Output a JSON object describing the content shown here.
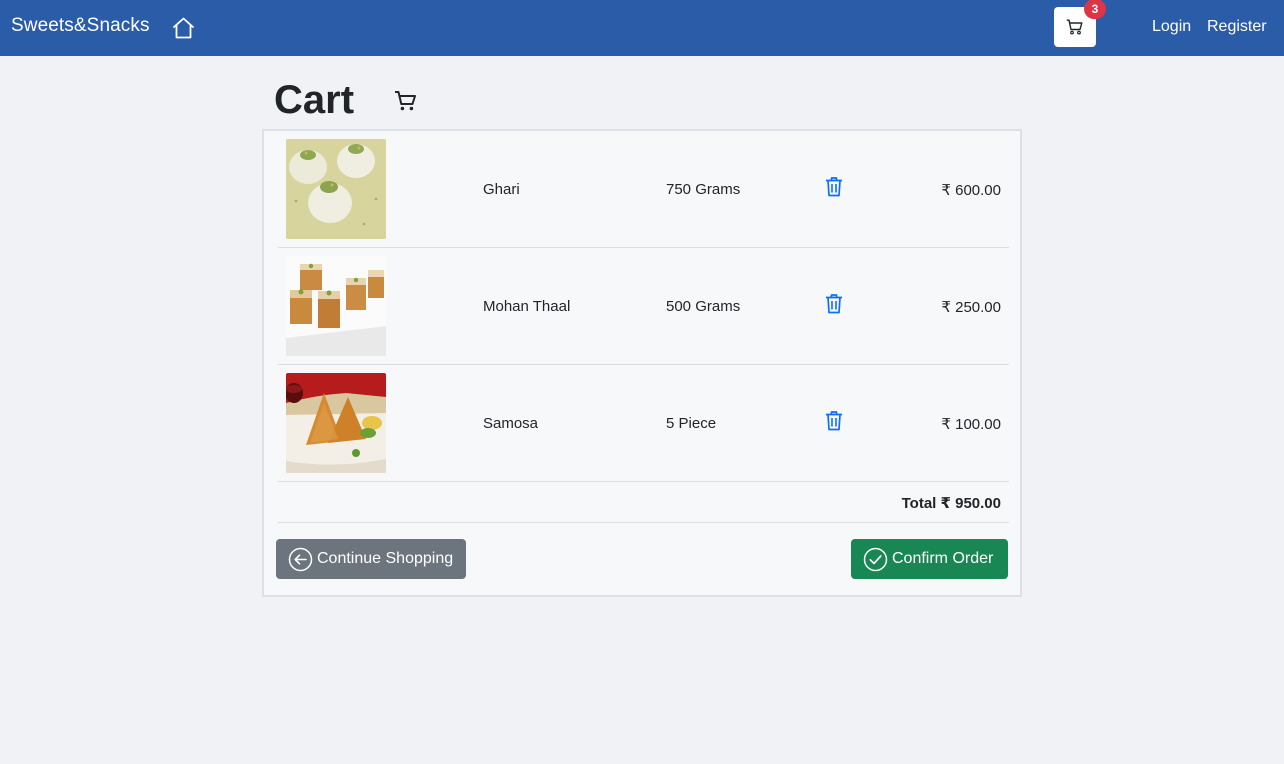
{
  "navbar": {
    "brand": "Sweets&Snacks",
    "home_icon": "home-icon",
    "cart_icon": "cart-icon",
    "cart_count": "3",
    "login": "Login",
    "register": "Register",
    "color": "#2a5ca8"
  },
  "page": {
    "title": "Cart",
    "title_icon": "shopping-cart-icon"
  },
  "cart": {
    "items": [
      {
        "name": "Ghari",
        "quantity": "750 Grams",
        "price": "₹ 600.00",
        "image": "ghari-sweet-image"
      },
      {
        "name": "Mohan Thaal",
        "quantity": "500 Grams",
        "price": "₹ 250.00",
        "image": "mohan-thaal-image"
      },
      {
        "name": "Samosa",
        "quantity": "5 Piece",
        "price": "₹ 100.00",
        "image": "samosa-image"
      }
    ],
    "total": "Total ₹ 950.00",
    "delete_icon": "trash-icon"
  },
  "actions": {
    "continue_label": "Continue Shopping",
    "confirm_label": "Confirm Order",
    "continue_color": "#6c757d",
    "confirm_color": "#198754"
  }
}
